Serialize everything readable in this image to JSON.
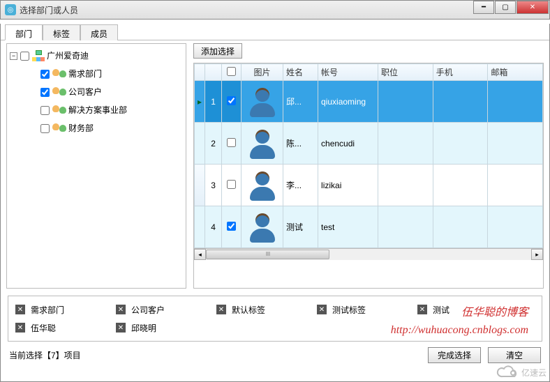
{
  "window": {
    "title": "选择部门或人员"
  },
  "tabs": [
    "部门",
    "标签",
    "成员"
  ],
  "active_tab": 0,
  "tree": {
    "root": {
      "label": "广州爱奇迪",
      "expanded": true,
      "checked": false
    },
    "children": [
      {
        "label": "需求部门",
        "checked": true
      },
      {
        "label": "公司客户",
        "checked": true
      },
      {
        "label": "解决方案事业部",
        "checked": false
      },
      {
        "label": "财务部",
        "checked": false
      }
    ]
  },
  "add_button": "添加选择",
  "grid": {
    "columns": [
      "",
      "",
      "图片",
      "姓名",
      "帐号",
      "职位",
      "手机",
      "邮箱"
    ],
    "rows": [
      {
        "n": "1",
        "checked": true,
        "name": "邱...",
        "acct": "qiuxiaoming",
        "selected": true
      },
      {
        "n": "2",
        "checked": false,
        "name": "陈...",
        "acct": "chencudi",
        "selected": false
      },
      {
        "n": "3",
        "checked": false,
        "name": "李...",
        "acct": "lizikai",
        "selected": false
      },
      {
        "n": "4",
        "checked": true,
        "name": "测试",
        "acct": "test",
        "selected": false
      }
    ]
  },
  "selected_tags": [
    "需求部门",
    "公司客户",
    "默认标签",
    "测试标签",
    "测试",
    "伍华聪",
    "邱晓明"
  ],
  "watermark": {
    "line1": "伍华聪的博客",
    "line2": "http://wuhuacong.cnblogs.com"
  },
  "footer": {
    "tpl": "当前选择【{n}】项目",
    "count": "7",
    "status": "当前选择【7】项目",
    "finish": "完成选择",
    "clear": "清空"
  },
  "cloud_brand": "亿速云"
}
